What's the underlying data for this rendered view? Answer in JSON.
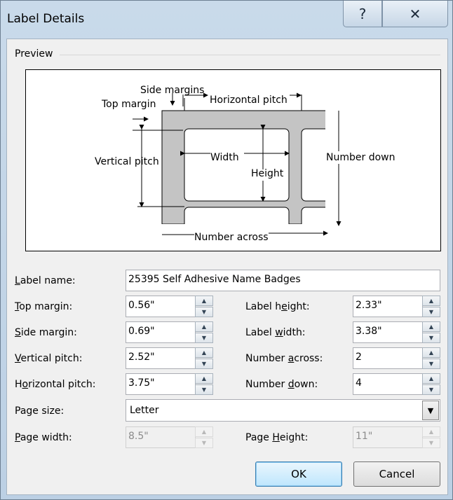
{
  "window": {
    "title": "Label Details",
    "help_glyph": "?",
    "close_glyph": "✕"
  },
  "preview": {
    "legend": "Preview",
    "diagram": {
      "side_margins": "Side margins",
      "top_margin": "Top margin",
      "horizontal_pitch": "Horizontal pitch",
      "vertical_pitch": "Vertical pitch",
      "width": "Width",
      "height": "Height",
      "number_down": "Number down",
      "number_across": "Number across"
    }
  },
  "fields": {
    "label_name": {
      "label_pre": "",
      "accel": "L",
      "label_post": "abel name:",
      "value": "25395 Self Adhesive Name Badges"
    },
    "top_margin": {
      "label_pre": "",
      "accel": "T",
      "label_post": "op margin:",
      "value": "0.56\""
    },
    "side_margin": {
      "label_pre": "",
      "accel": "S",
      "label_post": "ide margin:",
      "value": "0.69\""
    },
    "vertical_pitch": {
      "label_pre": "",
      "accel": "V",
      "label_post": "ertical pitch:",
      "value": "2.52\""
    },
    "horizontal_pitch": {
      "label_pre": "H",
      "accel": "o",
      "label_post": "rizontal pitch:",
      "value": "3.75\""
    },
    "label_height": {
      "label_pre": "Label h",
      "accel": "e",
      "label_post": "ight:",
      "value": "2.33\""
    },
    "label_width": {
      "label_pre": "Label ",
      "accel": "w",
      "label_post": "idth:",
      "value": "3.38\""
    },
    "number_across": {
      "label_pre": "Number ",
      "accel": "a",
      "label_post": "cross:",
      "value": "2"
    },
    "number_down": {
      "label_pre": "Number ",
      "accel": "d",
      "label_post": "own:",
      "value": "4"
    },
    "page_size": {
      "label": "Page size:",
      "value": "Letter"
    },
    "page_width": {
      "label_pre": "",
      "accel": "P",
      "label_post": "age width:",
      "value": "8.5\""
    },
    "page_height": {
      "label_pre": "Page ",
      "accel": "H",
      "label_post": "eight:",
      "value": "11\""
    }
  },
  "buttons": {
    "ok": "OK",
    "cancel": "Cancel"
  },
  "colors": {
    "label_stock": "#c4c4c4",
    "ok_accent": "#3c7fb1"
  }
}
